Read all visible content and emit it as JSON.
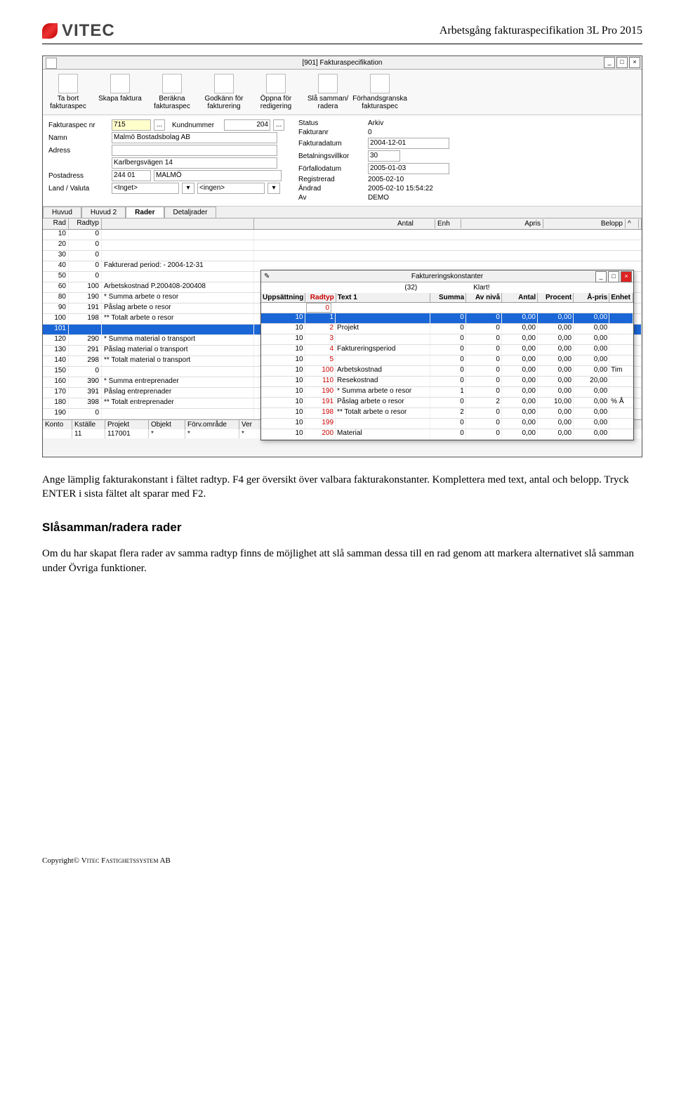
{
  "page_header": {
    "logo_text": "VITEC",
    "doc_title": "Arbetsgång fakturaspecifikation 3L Pro 2015"
  },
  "main_window": {
    "title": "[901]  Fakturaspecifikation",
    "toolbar": [
      {
        "label": "Ta bort fakturaspec"
      },
      {
        "label": "Skapa faktura"
      },
      {
        "label": "Beräkna fakturaspec"
      },
      {
        "label": "Godkänn för fakturering"
      },
      {
        "label": "Öppna för redigering"
      },
      {
        "label": "Slå samman/ radera"
      },
      {
        "label": "Förhandsgranska fakturaspec"
      }
    ],
    "form": {
      "fakturaspec_nr_label": "Fakturaspec nr",
      "fakturaspec_nr": "715",
      "kundnummer_label": "Kundnummer",
      "kundnummer": "204",
      "namn_label": "Namn",
      "namn": "Malmö Bostadsbolag AB",
      "adress_label": "Adress",
      "adress": "",
      "adress2": "Karlbergsvägen 14",
      "postadress_label": "Postadress",
      "postnr": "244 01",
      "postort": "MALMÖ",
      "land_valuta_label": "Land / Valuta",
      "land": "<Inget>",
      "valuta": "<ingen>",
      "status_label": "Status",
      "status": "Arkiv",
      "fakturanr_label": "Fakturanr",
      "fakturanr": "0",
      "fakturadatum_label": "Fakturadatum",
      "fakturadatum": "2004-12-01",
      "betalningsvillkor_label": "Betalningsvillkor",
      "betalningsvillkor": "30",
      "forfalldatum_label": "Förfallodatum",
      "forfalldatum": "2005-01-03",
      "registrerad_label": "Registrerad",
      "registrerad": "2005-02-10",
      "andrad_label": "Ändrad",
      "andrad": "2005-02-10 15:54:22",
      "av_label": "Av",
      "av": "DEMO"
    },
    "tabs": [
      "Huvud",
      "Huvud 2",
      "Rader",
      "Detaljrader"
    ],
    "active_tab": "Rader",
    "grid_columns": {
      "rad": "Rad",
      "radtyp": "Radtyp",
      "antal": "Antal",
      "enh": "Enh",
      "apris": "Apris",
      "belopp": "Belopp"
    },
    "rows": [
      {
        "rad": "10",
        "radtyp": "0",
        "text": ""
      },
      {
        "rad": "20",
        "radtyp": "0",
        "text": ""
      },
      {
        "rad": "30",
        "radtyp": "0",
        "text": ""
      },
      {
        "rad": "40",
        "radtyp": "0",
        "text": "Fakturerad period:  - 2004-12-31"
      },
      {
        "rad": "50",
        "radtyp": "0",
        "text": ""
      },
      {
        "rad": "60",
        "radtyp": "100",
        "text": "Arbetskostnad P.200408-200408"
      },
      {
        "rad": "80",
        "radtyp": "190",
        "text": "* Summa arbete o resor"
      },
      {
        "rad": "90",
        "radtyp": "191",
        "text": "Påslag arbete o resor"
      },
      {
        "rad": "100",
        "radtyp": "198",
        "text": "** Totalt arbete o resor"
      },
      {
        "rad": "101",
        "radtyp": "",
        "text": "",
        "selected": true
      },
      {
        "rad": "120",
        "radtyp": "290",
        "text": "* Summa material o transport"
      },
      {
        "rad": "130",
        "radtyp": "291",
        "text": "Påslag material o transport"
      },
      {
        "rad": "140",
        "radtyp": "298",
        "text": "** Totalt material o transport"
      },
      {
        "rad": "150",
        "radtyp": "0",
        "text": ""
      },
      {
        "rad": "160",
        "radtyp": "390",
        "text": "* Summa entreprenader"
      },
      {
        "rad": "170",
        "radtyp": "391",
        "text": "Påslag entreprenader"
      },
      {
        "rad": "180",
        "radtyp": "398",
        "text": "** Totalt entreprenader"
      },
      {
        "rad": "190",
        "radtyp": "0",
        "text": ""
      }
    ],
    "bottom_labels": {
      "konto": "Konto",
      "kstalle": "Kställe",
      "projekt": "Projekt",
      "objekt": "Objekt",
      "forv": "Förv.område",
      "ver": "Ver"
    },
    "bottom_values": {
      "konto": "",
      "kstalle": "11",
      "projekt": "117001",
      "objekt": "*",
      "forv": "*",
      "ver": "*"
    }
  },
  "popup": {
    "title": "Faktureringskonstanter",
    "sub_left": "(32)",
    "sub_right": "Klart!",
    "columns": {
      "upp": "Uppsättning",
      "radtyp": "Radtyp",
      "text": "Text 1",
      "summa": "Summa",
      "avniva": "Av nivå",
      "antal": "Antal",
      "procent": "Procent",
      "apris": "Å-pris",
      "enhet": "Enhet"
    },
    "input_value": "0",
    "rows": [
      {
        "upp": "10",
        "radtyp": "1",
        "text": "",
        "summa": "0",
        "avniva": "0",
        "antal": "0,00",
        "procent": "0,00",
        "apris": "0,00",
        "enhet": "",
        "selected": true
      },
      {
        "upp": "10",
        "radtyp": "2",
        "text": "Projekt",
        "summa": "0",
        "avniva": "0",
        "antal": "0,00",
        "procent": "0,00",
        "apris": "0,00",
        "enhet": ""
      },
      {
        "upp": "10",
        "radtyp": "3",
        "text": "",
        "summa": "0",
        "avniva": "0",
        "antal": "0,00",
        "procent": "0,00",
        "apris": "0,00",
        "enhet": ""
      },
      {
        "upp": "10",
        "radtyp": "4",
        "text": "Faktureringsperiod",
        "summa": "0",
        "avniva": "0",
        "antal": "0,00",
        "procent": "0,00",
        "apris": "0,00",
        "enhet": ""
      },
      {
        "upp": "10",
        "radtyp": "5",
        "text": "",
        "summa": "0",
        "avniva": "0",
        "antal": "0,00",
        "procent": "0,00",
        "apris": "0,00",
        "enhet": ""
      },
      {
        "upp": "10",
        "radtyp": "100",
        "text": "Arbetskostnad",
        "summa": "0",
        "avniva": "0",
        "antal": "0,00",
        "procent": "0,00",
        "apris": "0,00",
        "enhet": "Tim"
      },
      {
        "upp": "10",
        "radtyp": "110",
        "text": "Resekostnad",
        "summa": "0",
        "avniva": "0",
        "antal": "0,00",
        "procent": "0,00",
        "apris": "20,00",
        "enhet": ""
      },
      {
        "upp": "10",
        "radtyp": "190",
        "text": "* Summa arbete o resor",
        "summa": "1",
        "avniva": "0",
        "antal": "0,00",
        "procent": "0,00",
        "apris": "0,00",
        "enhet": ""
      },
      {
        "upp": "10",
        "radtyp": "191",
        "text": "Påslag arbete o resor",
        "summa": "0",
        "avniva": "2",
        "antal": "0,00",
        "procent": "10,00",
        "apris": "0,00",
        "enhet": "% Å"
      },
      {
        "upp": "10",
        "radtyp": "198",
        "text": "** Totalt arbete o resor",
        "summa": "2",
        "avniva": "0",
        "antal": "0,00",
        "procent": "0,00",
        "apris": "0,00",
        "enhet": ""
      },
      {
        "upp": "10",
        "radtyp": "199",
        "text": "",
        "summa": "0",
        "avniva": "0",
        "antal": "0,00",
        "procent": "0,00",
        "apris": "0,00",
        "enhet": ""
      },
      {
        "upp": "10",
        "radtyp": "200",
        "text": "Material",
        "summa": "0",
        "avniva": "0",
        "antal": "0,00",
        "procent": "0,00",
        "apris": "0,00",
        "enhet": ""
      }
    ]
  },
  "body_text": {
    "p1": "Ange lämplig fakturakonstant i fältet radtyp. F4 ger översikt över valbara fakturakonstanter. Komplettera med text, antal och belopp. Tryck ENTER i sista fältet alt sparar med F2.",
    "h": "Slåsamman/radera rader",
    "p2": "Om du har skapat flera rader av samma radtyp finns de möjlighet att slå samman dessa till en rad genom att markera alternativet slå samman under Övriga funktioner."
  },
  "footer": {
    "text": "Copyright© VITEC FASTIGHETSSYSTEM AB"
  }
}
